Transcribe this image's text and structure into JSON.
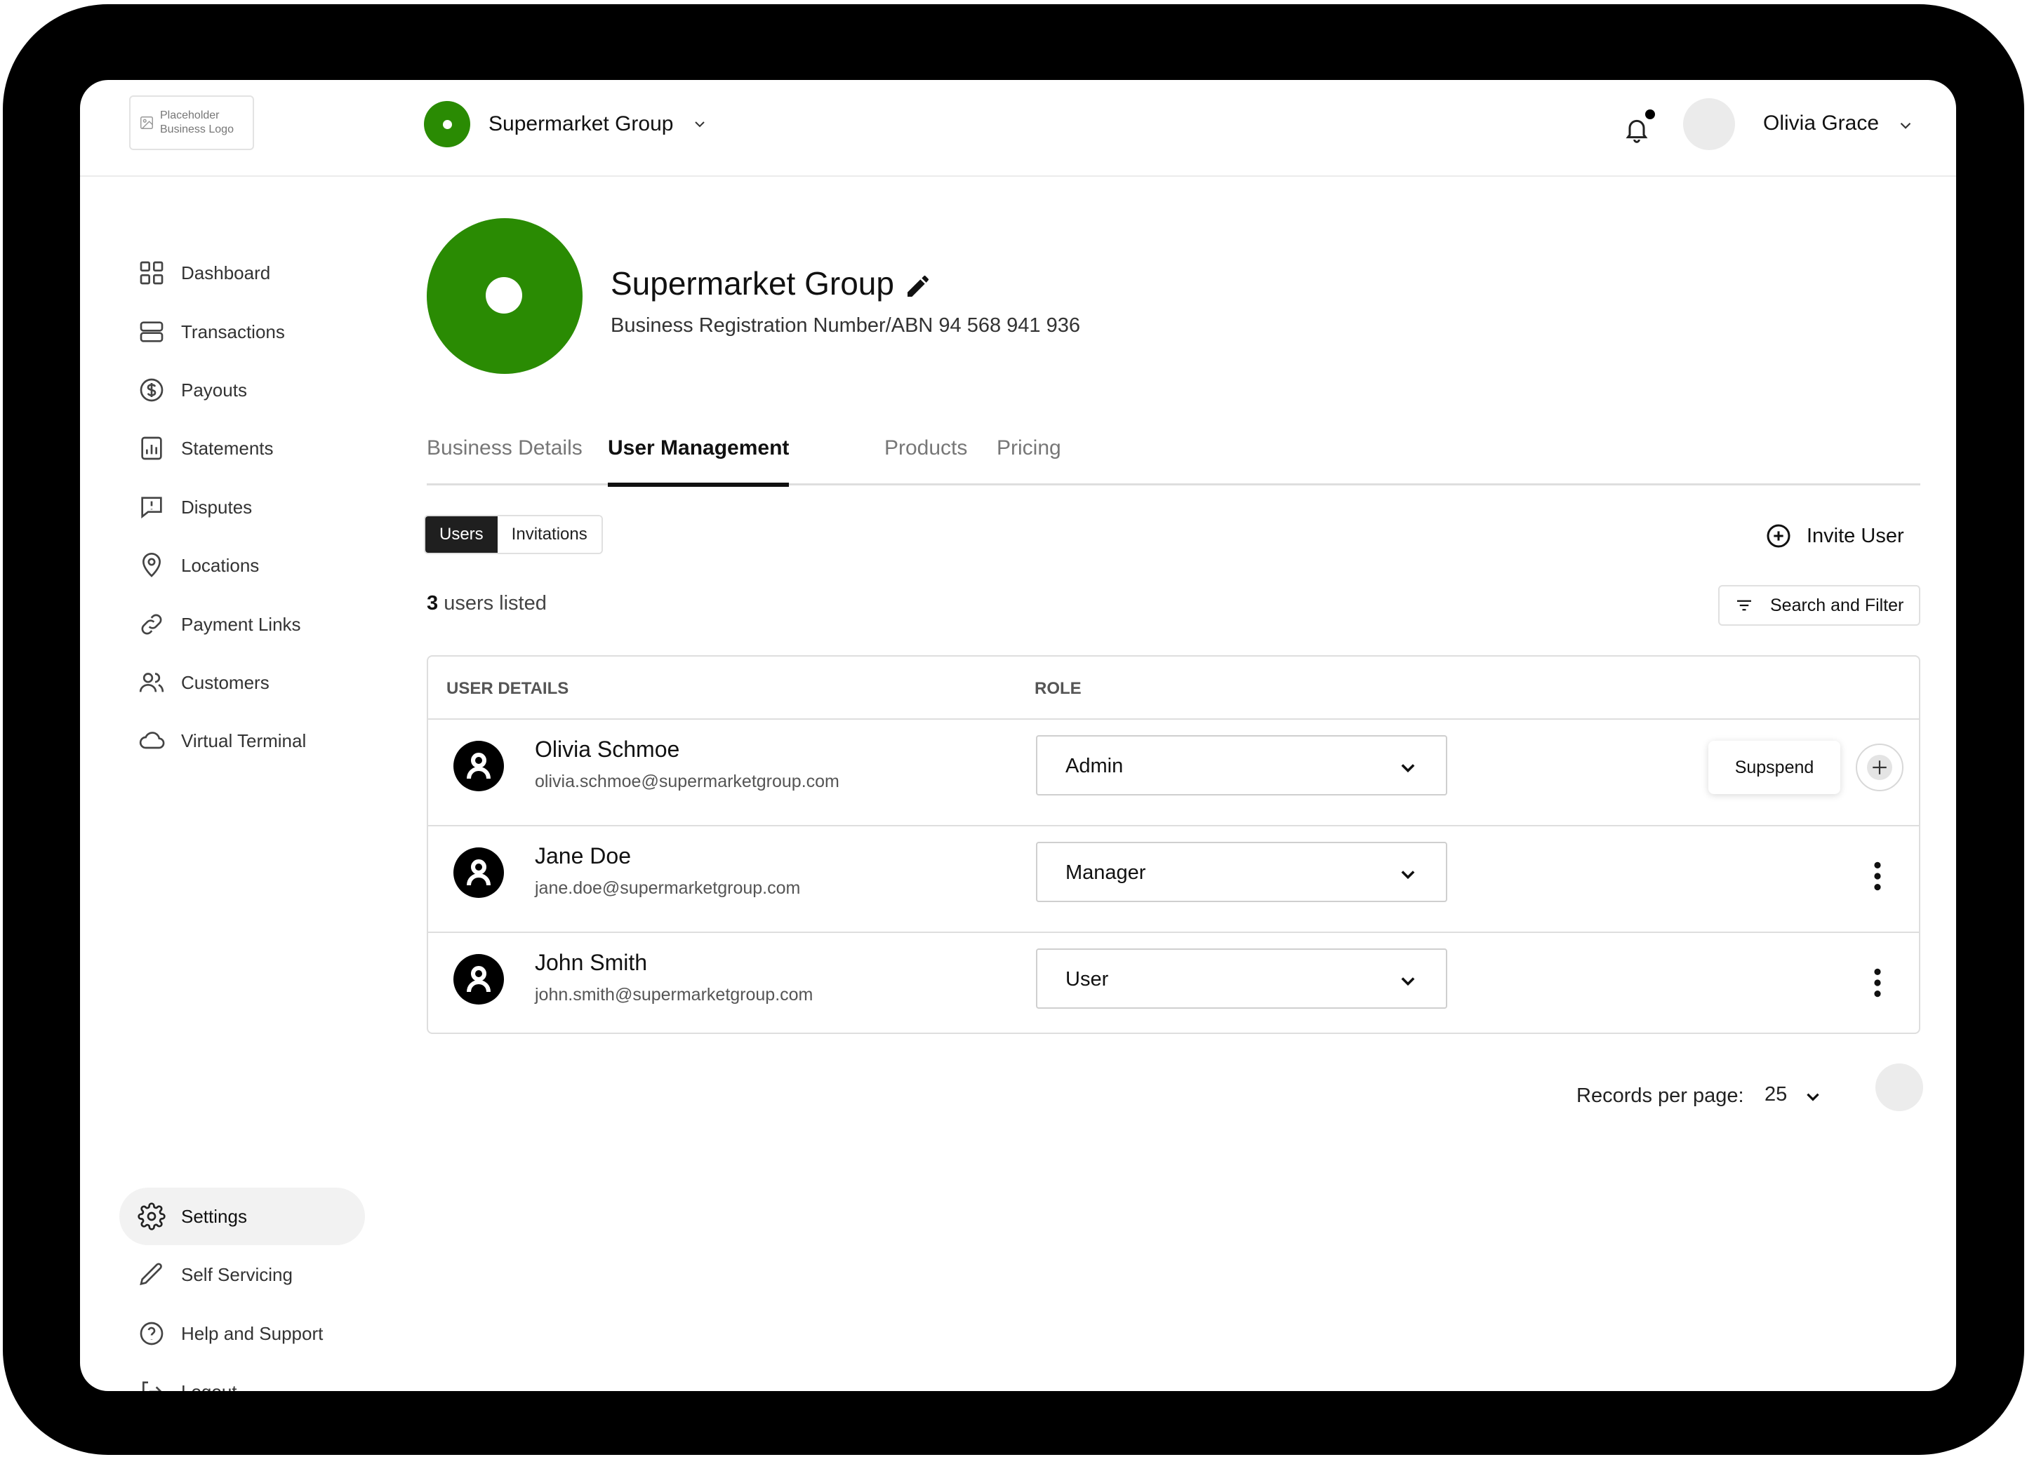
{
  "header": {
    "logo_text": "Placeholder Business Logo",
    "business_name": "Supermarket Group",
    "user_name": "Olivia Grace"
  },
  "sidebar": {
    "items": [
      {
        "label": "Dashboard",
        "icon": "grid-icon"
      },
      {
        "label": "Transactions",
        "icon": "server-icon"
      },
      {
        "label": "Payouts",
        "icon": "dollar-icon"
      },
      {
        "label": "Statements",
        "icon": "bar-chart-icon"
      },
      {
        "label": "Disputes",
        "icon": "alert-message-icon"
      },
      {
        "label": "Locations",
        "icon": "map-pin-icon"
      },
      {
        "label": "Payment Links",
        "icon": "link-icon"
      },
      {
        "label": "Customers",
        "icon": "users-icon"
      },
      {
        "label": "Virtual Terminal",
        "icon": "cloud-icon"
      }
    ],
    "bottom_items": [
      {
        "label": "Settings",
        "icon": "gear-icon",
        "active": true
      },
      {
        "label": "Self Servicing",
        "icon": "pencil-icon"
      },
      {
        "label": "Help and Support",
        "icon": "help-icon"
      },
      {
        "label": "Logout",
        "icon": "logout-icon"
      }
    ]
  },
  "profile": {
    "title": "Supermarket Group",
    "subtitle": "Business Registration Number/ABN 94 568 941 936"
  },
  "tabs": [
    {
      "label": "Business Details",
      "active": false
    },
    {
      "label": "User Management",
      "active": true
    },
    {
      "label": "Products",
      "active": false
    },
    {
      "label": "Pricing",
      "active": false
    }
  ],
  "segment": {
    "users": "Users",
    "invitations": "Invitations"
  },
  "invite_label": "Invite User",
  "count": {
    "number": "3",
    "suffix": " users listed"
  },
  "filter_label": "Search and Filter",
  "table": {
    "headers": {
      "details": "USER DETAILS",
      "role": "ROLE"
    },
    "rows": [
      {
        "name": "Olivia Schmoe",
        "email": "olivia.schmoe@supermarketgroup.com",
        "role": "Admin",
        "action": "Supspend"
      },
      {
        "name": "Jane Doe",
        "email": "jane.doe@supermarketgroup.com",
        "role": "Manager"
      },
      {
        "name": "John Smith",
        "email": "john.smith@supermarketgroup.com",
        "role": "User"
      }
    ]
  },
  "pagination": {
    "label": "Records per page:",
    "value": "25"
  },
  "colors": {
    "brand_green": "#2a8b03",
    "dark": "#1f1f1f"
  }
}
